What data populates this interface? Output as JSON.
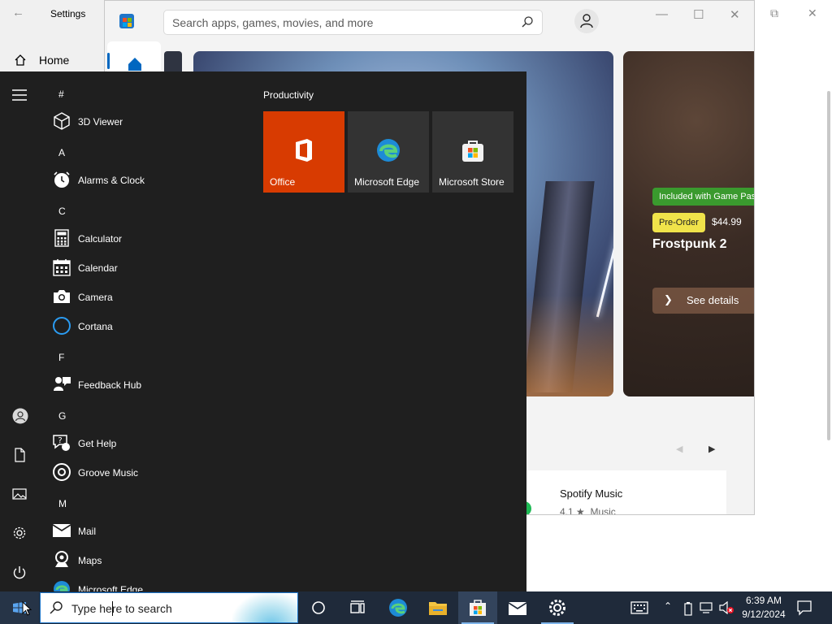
{
  "settings": {
    "title": "Settings",
    "back_icon": "arrow-left-icon",
    "home_label": "Home",
    "scrollbar_visible": true
  },
  "store": {
    "search_placeholder": "Search apps, games, movies, and more",
    "hero_right": {
      "badge": "Included with Game Pass",
      "preorder": "Pre-Order",
      "price": "$44.99",
      "title": "Frostpunk 2",
      "cta": "See details"
    },
    "featured_app": {
      "name": "Spotify Music",
      "rating": "4.1 ★",
      "category": "Music"
    },
    "accent": "#0067c0"
  },
  "start_menu": {
    "tiles_group": "Productivity",
    "tiles": [
      {
        "label": "Office",
        "icon": "office-icon",
        "color": "#d83b01"
      },
      {
        "label": "Microsoft Edge",
        "icon": "edge-icon",
        "color": "#333333"
      },
      {
        "label": "Microsoft Store",
        "icon": "store-icon",
        "color": "#333333"
      }
    ],
    "groups": [
      {
        "letter": "#",
        "apps": [
          {
            "label": "3D Viewer",
            "icon": "cube-icon"
          }
        ]
      },
      {
        "letter": "A",
        "apps": [
          {
            "label": "Alarms & Clock",
            "icon": "clock-icon"
          }
        ]
      },
      {
        "letter": "C",
        "apps": [
          {
            "label": "Calculator",
            "icon": "calculator-icon"
          },
          {
            "label": "Calendar",
            "icon": "calendar-icon"
          },
          {
            "label": "Camera",
            "icon": "camera-icon"
          },
          {
            "label": "Cortana",
            "icon": "cortana-icon"
          }
        ]
      },
      {
        "letter": "F",
        "apps": [
          {
            "label": "Feedback Hub",
            "icon": "feedback-icon"
          }
        ]
      },
      {
        "letter": "G",
        "apps": [
          {
            "label": "Get Help",
            "icon": "help-icon"
          },
          {
            "label": "Groove Music",
            "icon": "music-icon"
          }
        ]
      },
      {
        "letter": "M",
        "apps": [
          {
            "label": "Mail",
            "icon": "mail-icon"
          },
          {
            "label": "Maps",
            "icon": "maps-icon"
          },
          {
            "label": "Microsoft Edge",
            "icon": "edge-icon"
          }
        ]
      }
    ]
  },
  "taskbar": {
    "search_placeholder": "Type here to search",
    "time": "6:39 AM",
    "date": "9/12/2024",
    "pinned": [
      "cortana-icon",
      "task-view-icon",
      "edge-icon",
      "file-explorer-icon",
      "store-icon",
      "mail-icon",
      "settings-icon"
    ],
    "tray": [
      "keyboard-icon",
      "chevron-up-icon",
      "battery-icon",
      "network-icon",
      "volume-muted-icon"
    ]
  }
}
